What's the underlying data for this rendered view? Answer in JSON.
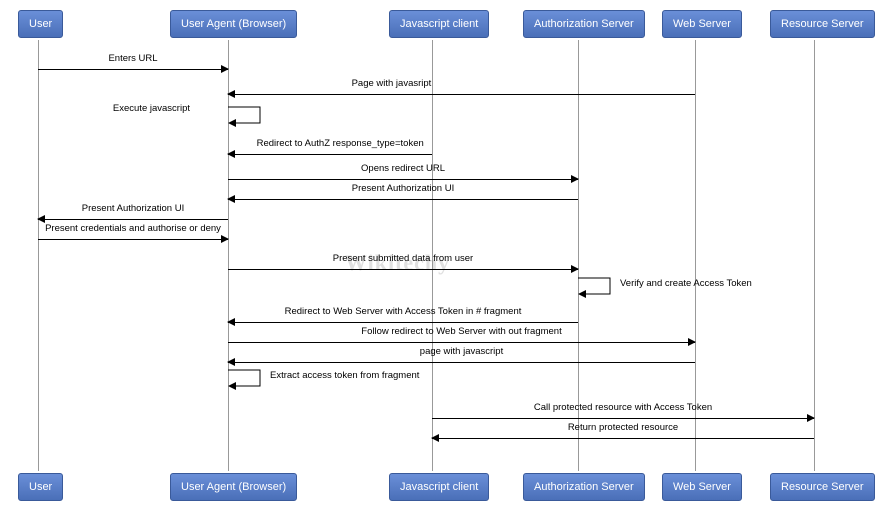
{
  "actors": {
    "user": "User",
    "userAgent": "User Agent (Browser)",
    "jsClient": "Javascript client",
    "authServer": "Authorization Server",
    "webServer": "Web Server",
    "resourceServer": "Resource Server"
  },
  "messages": {
    "m1": "Enters URL",
    "m2": "Page with javasript",
    "m3": "Execute javascript",
    "m4": "Redirect to AuthZ response_type=token",
    "m5": "Opens redirect URL",
    "m6": "Present Authorization UI",
    "m7": "Present Authorization UI",
    "m8": "Present credentials and authorise or deny",
    "m9": "Present submitted data from user",
    "m10": "Verify and create Access Token",
    "m11": "Redirect to Web Server with Access Token in # fragment",
    "m12": "Follow redirect to Web Server with out fragment",
    "m13": "page with javascript",
    "m14": "Extract access token from fragment",
    "m15": "Call protected resource with Access Token",
    "m16": "Return protected resource"
  },
  "watermark": "Wikitechy"
}
